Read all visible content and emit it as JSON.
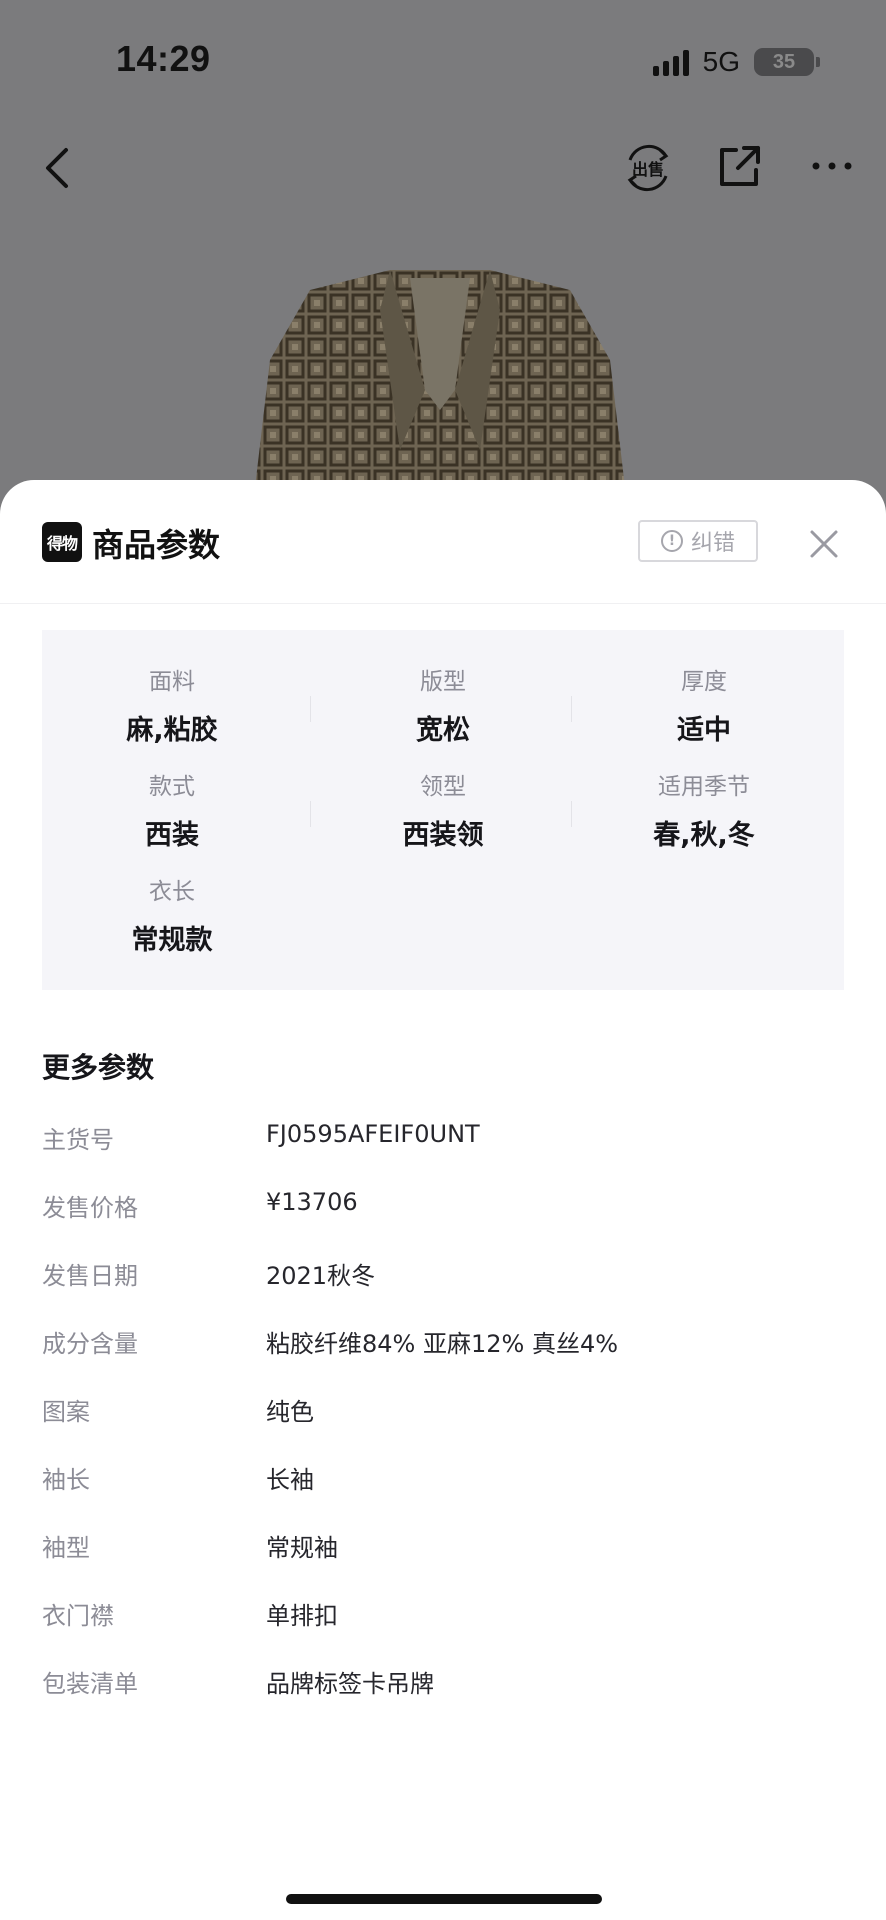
{
  "status_bar": {
    "time": "14:29",
    "network": "5G",
    "battery": "35"
  },
  "nav": {
    "icons": [
      "back-icon",
      "sell-icon",
      "share-icon",
      "more-icon"
    ],
    "sell_icon_text": "出售"
  },
  "sheet": {
    "logo_text": "得物",
    "title": "商品参数",
    "report_label": "纠错",
    "key_params": [
      {
        "label": "面料",
        "value": "麻,粘胶"
      },
      {
        "label": "版型",
        "value": "宽松"
      },
      {
        "label": "厚度",
        "value": "适中"
      },
      {
        "label": "款式",
        "value": "西装"
      },
      {
        "label": "领型",
        "value": "西装领"
      },
      {
        "label": "适用季节",
        "value": "春,秋,冬"
      },
      {
        "label": "衣长",
        "value": "常规款"
      }
    ],
    "more_title": "更多参数",
    "more_params": [
      {
        "label": "主货号",
        "value": "FJ0595AFEIF0UNT"
      },
      {
        "label": "发售价格",
        "value": "¥13706"
      },
      {
        "label": "发售日期",
        "value": "2021秋冬"
      },
      {
        "label": "成分含量",
        "value": "粘胶纤维84% 亚麻12% 真丝4%"
      },
      {
        "label": "图案",
        "value": "纯色"
      },
      {
        "label": "袖长",
        "value": "长袖"
      },
      {
        "label": "袖型",
        "value": "常规袖"
      },
      {
        "label": "衣门襟",
        "value": "单排扣"
      },
      {
        "label": "包装清单",
        "value": "品牌标签卡吊牌"
      }
    ]
  },
  "colors": {
    "backdrop": "#7b7b7d",
    "card_bg": "#f5f5f9",
    "label_gray": "#8c8c96",
    "text_dark": "#16161a"
  }
}
